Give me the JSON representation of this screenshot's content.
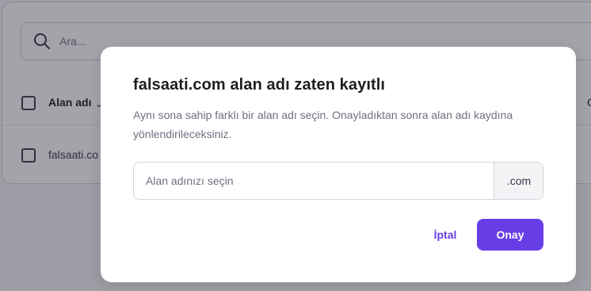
{
  "background": {
    "search": {
      "placeholder": "Ara..."
    },
    "table": {
      "header_label": "Alan adı",
      "rows": [
        {
          "label": "falsaati.co"
        }
      ]
    },
    "edge_glyph": "C"
  },
  "modal": {
    "title": "falsaati.com alan adı zaten kayıtlı",
    "description": "Aynı sona sahip farklı bir alan adı seçin. Onayladıktan sonra alan adı kaydına yönlendirileceksiniz.",
    "domain_input": {
      "placeholder": "Alan adınızı seçin",
      "value": ""
    },
    "domain_suffix": ".com",
    "cancel_label": "İptal",
    "confirm_label": "Onay"
  },
  "colors": {
    "accent": "#673de6",
    "overlay": "rgba(36,36,52,0.42)",
    "text_primary": "#1d1e20",
    "text_secondary": "#6d7081"
  },
  "icons": [
    "search-icon",
    "sort-icon",
    "checkbox"
  ]
}
